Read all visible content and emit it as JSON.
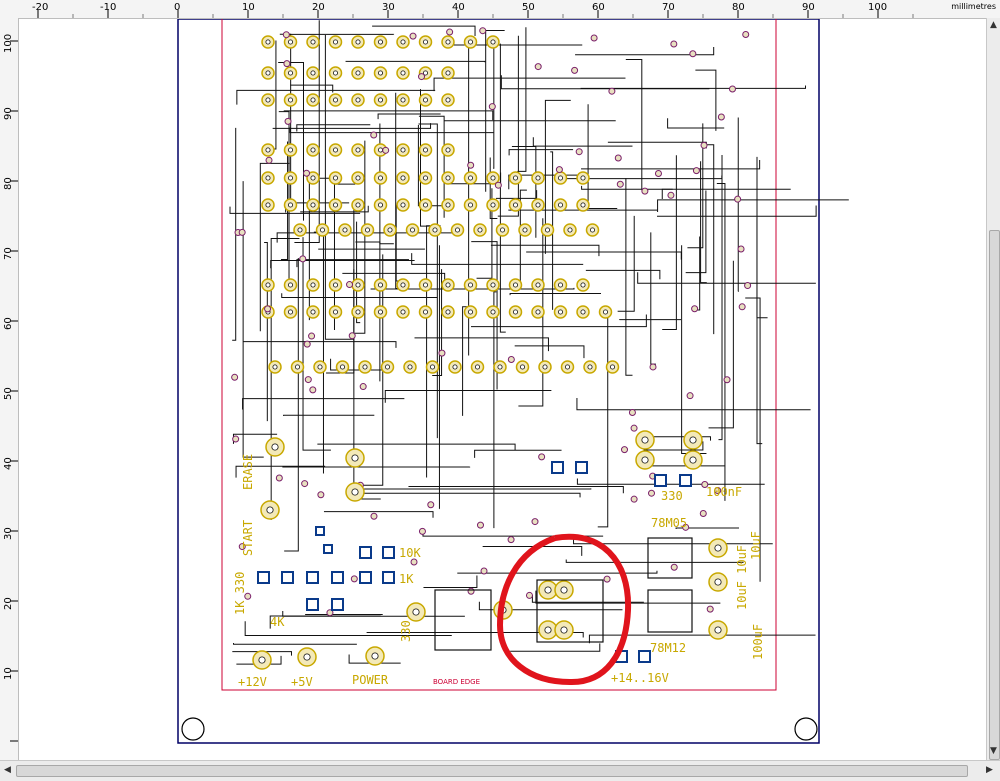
{
  "ruler": {
    "units": "millimetres",
    "x_ticks": [
      "-20",
      "-10",
      "0",
      "10",
      "20",
      "30",
      "40",
      "50",
      "60",
      "70",
      "80",
      "90",
      "100"
    ],
    "y_ticks": [
      "100",
      "90",
      "80",
      "70",
      "60",
      "50",
      "40",
      "30",
      "20",
      "10"
    ]
  },
  "pcb": {
    "labels": {
      "erase": "ERASE",
      "start": "START",
      "r_330": "1K 330",
      "k10": "10K",
      "k1": "1K",
      "k4": "4K",
      "r330b": "330",
      "r330c": "330",
      "c100nf": "100nF",
      "c10uf": "10uF",
      "c10uf2": "10uF 10uF",
      "c100uf": "100uF",
      "reg1": "78M05",
      "reg2": "78M12",
      "v12": "+12V",
      "v5": "+5V",
      "power": "POWER",
      "board_edge": "BOARD EDGE",
      "vin": "+14..16V"
    },
    "colors": {
      "pad": "#c8a800",
      "trace": "#111111",
      "highlight": "#e0141c",
      "board_outline": "#cc0033",
      "frame": "#000066"
    }
  }
}
